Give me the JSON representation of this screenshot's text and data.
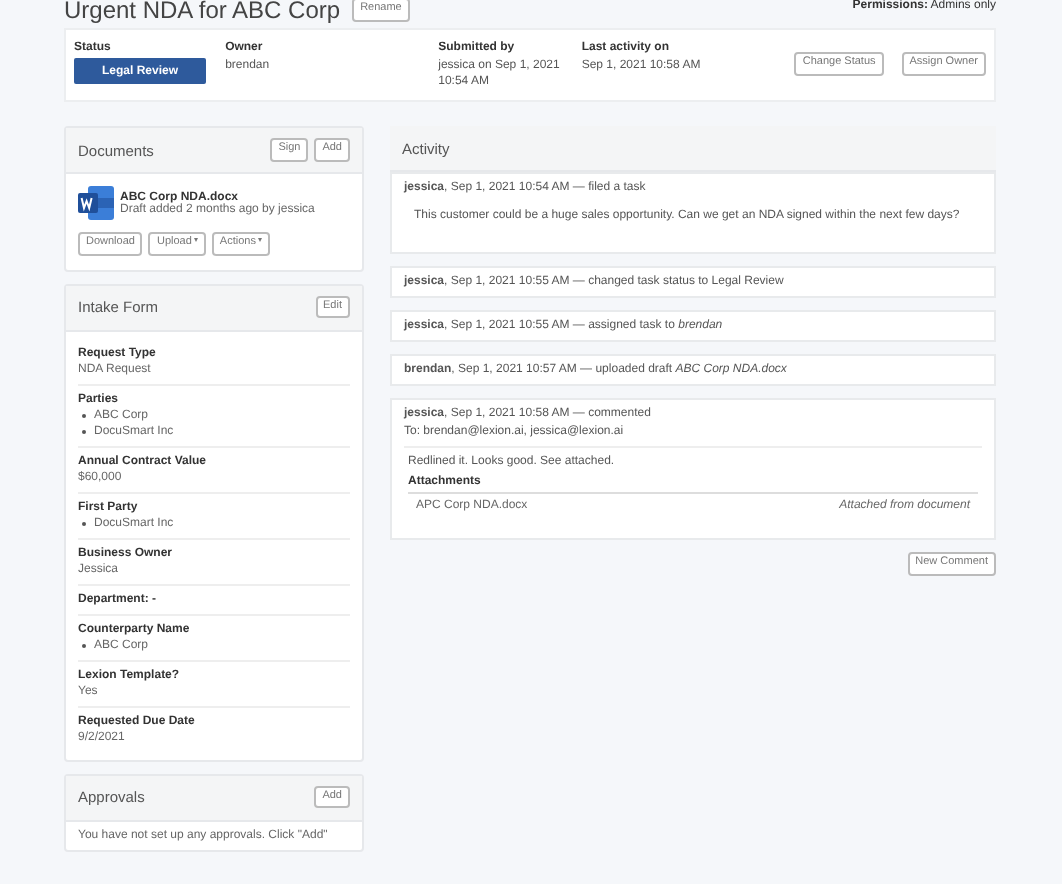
{
  "title": "Urgent NDA for ABC Corp",
  "rename_button": "Rename",
  "permissions": {
    "label": "Permissions:",
    "value": "Admins only"
  },
  "header": {
    "fields": [
      {
        "kind": "badge",
        "label": "Status",
        "value": "Legal Review"
      },
      {
        "kind": "text",
        "label": "Owner",
        "value": "brendan"
      },
      {
        "kind": "text",
        "label": "Submitted by",
        "value": "jessica on Sep 1, 2021 10:54 AM"
      },
      {
        "kind": "text",
        "label": "Last activity on",
        "value": "Sep 1, 2021 10:58 AM"
      }
    ],
    "buttons": [
      "Change Status",
      "Assign Owner"
    ]
  },
  "documents": {
    "title": "Documents",
    "buttons": [
      "Sign",
      "Add"
    ],
    "files": [
      {
        "name": "ABC Corp NDA.docx",
        "meta": "Draft added 2 months ago by jessica",
        "actions": [
          {
            "label": "Download",
            "dropdown": false
          },
          {
            "label": "Upload",
            "dropdown": true
          },
          {
            "label": "Actions",
            "dropdown": true
          }
        ]
      }
    ]
  },
  "intake_form": {
    "title": "Intake Form",
    "edit_button": "Edit",
    "fields": [
      {
        "kind": "text",
        "label": "Request Type",
        "value": "NDA Request"
      },
      {
        "kind": "list",
        "label": "Parties",
        "values": [
          "ABC Corp",
          "DocuSmart Inc"
        ]
      },
      {
        "kind": "text",
        "label": "Annual Contract Value",
        "value": "$60,000"
      },
      {
        "kind": "list",
        "label": "First Party",
        "values": [
          "DocuSmart Inc"
        ]
      },
      {
        "kind": "text",
        "label": "Business Owner",
        "value": "Jessica"
      },
      {
        "kind": "inline",
        "label": "Department: -"
      },
      {
        "kind": "list",
        "label": "Counterparty Name",
        "values": [
          "ABC Corp"
        ]
      },
      {
        "kind": "text",
        "label": "Lexion Template?",
        "value": "Yes"
      },
      {
        "kind": "text",
        "label": "Requested Due Date",
        "value": "9/2/2021"
      }
    ]
  },
  "approvals": {
    "title": "Approvals",
    "add_button": "Add",
    "message": "You have not set up any approvals. Click \"Add\""
  },
  "activity": {
    "title": "Activity",
    "entries": [
      {
        "author": "jessica",
        "text": ", Sep 1, 2021 10:54 AM — filed a task",
        "body": "This customer could be a huge sales opportunity. Can we get an NDA signed within the next few days?"
      },
      {
        "author": "jessica",
        "text": ", Sep 1, 2021 10:55 AM — changed task status to Legal Review"
      },
      {
        "author": "jessica",
        "text": ", Sep 1, 2021 10:55 AM — assigned task to *brendan*"
      },
      {
        "author": "brendan",
        "text": ", Sep 1, 2021 10:57 AM — uploaded draft *ABC Corp NDA.docx*"
      },
      {
        "author": "jessica",
        "text": ", Sep 1, 2021 10:58 AM — commented",
        "to": "To: brendan@lexion.ai, jessica@lexion.ai",
        "body": "Redlined it. Looks good. See attached.",
        "attachments_title": "Attachments",
        "attachments": [
          {
            "name": "APC Corp NDA.docx",
            "source": "Attached from document"
          }
        ]
      }
    ],
    "new_comment_button": "New Comment"
  }
}
